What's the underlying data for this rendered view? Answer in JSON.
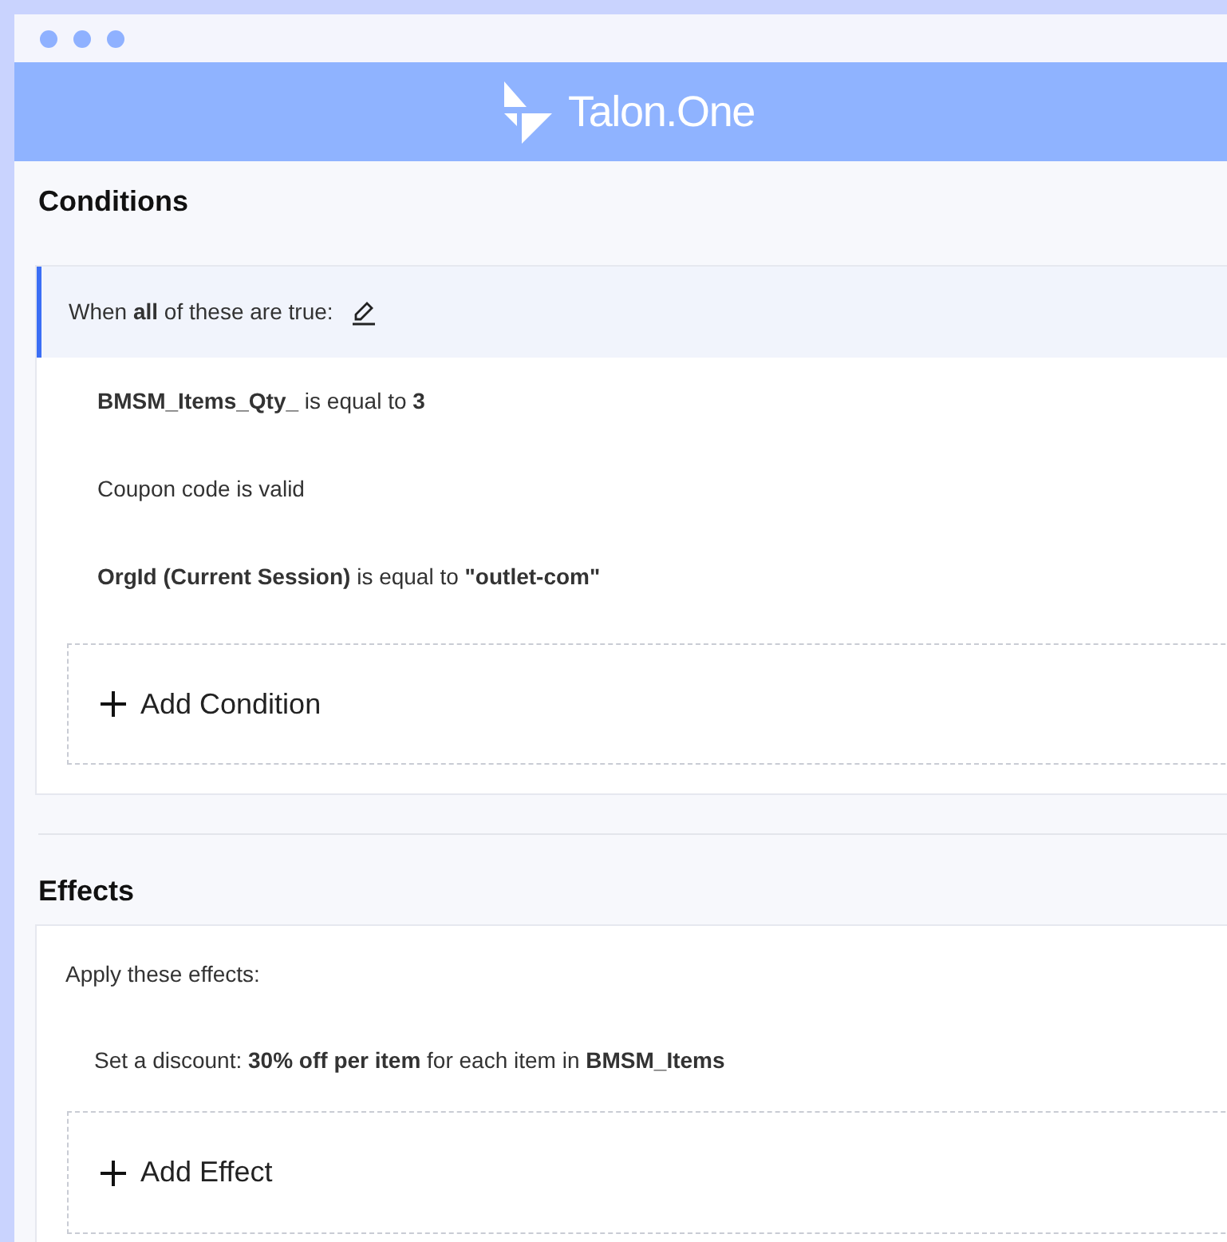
{
  "header": {
    "brand": "Talon.One"
  },
  "conditions": {
    "title": "Conditions",
    "heading": "When **all** of these are true:",
    "items": [
      "**BMSM_Items_Qty_** is equal to **3**",
      "Coupon code is valid",
      "**OrgId (Current Session)** is equal to **\"outlet-com\"**"
    ],
    "add_button": "Add Condition"
  },
  "effects": {
    "title": "Effects",
    "heading": "Apply these effects:",
    "items": [
      "Set a discount: **30% off per item** for each item in **BMSM_Items**"
    ],
    "add_button": "Add Effect"
  }
}
